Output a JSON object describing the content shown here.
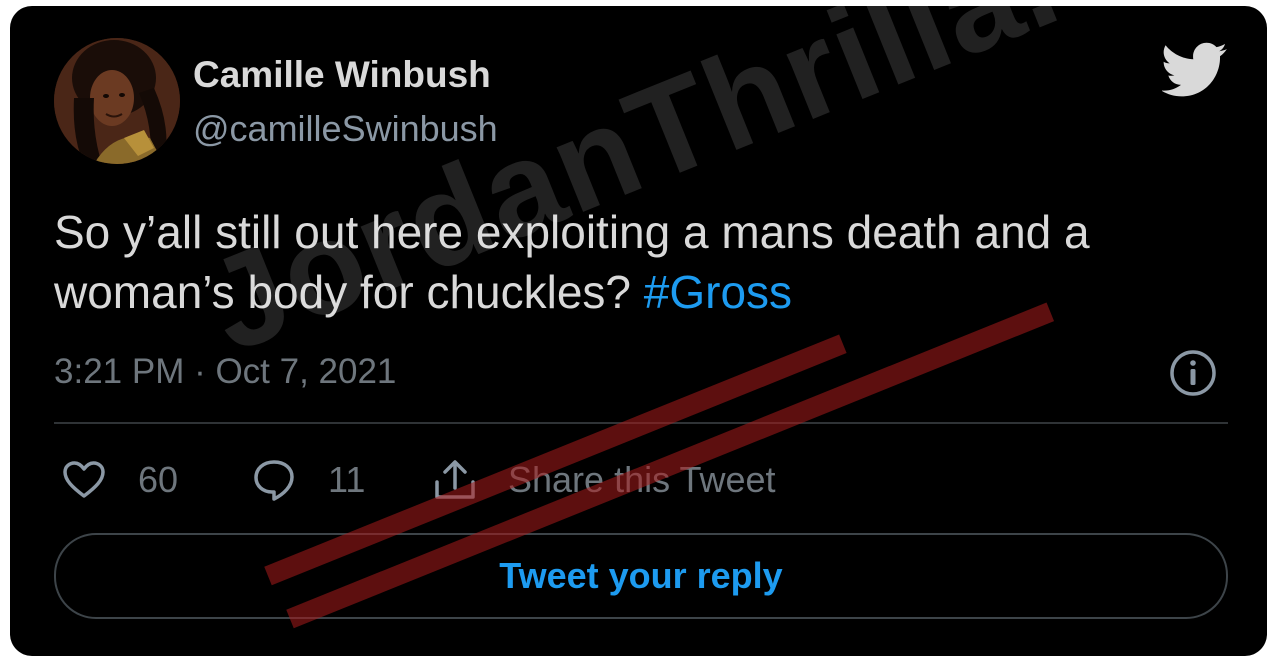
{
  "tweet": {
    "author_name": "Camille Winbush",
    "author_handle": "@camilleSwinbush",
    "text": "So y’all still out here exploiting a mans death and a woman’s body for chuckles?",
    "hashtag": "#Gross",
    "timestamp": "3:21 PM · Oct 7, 2021",
    "likes": "60",
    "replies": "11",
    "share_label": "Share this Tweet",
    "reply_button_label": "Tweet your reply"
  },
  "icons": {
    "brand": "twitter-bird-icon",
    "info": "info-icon",
    "like": "heart-icon",
    "reply": "reply-bubble-icon",
    "share": "share-icon"
  },
  "watermark": {
    "text": "JordanThrilla."
  },
  "colors": {
    "background": "#000000",
    "text": "#d9d9d9",
    "muted": "#6e767d",
    "accent": "#1d9bf0",
    "watermark_stripe": "#aa1c1c"
  }
}
